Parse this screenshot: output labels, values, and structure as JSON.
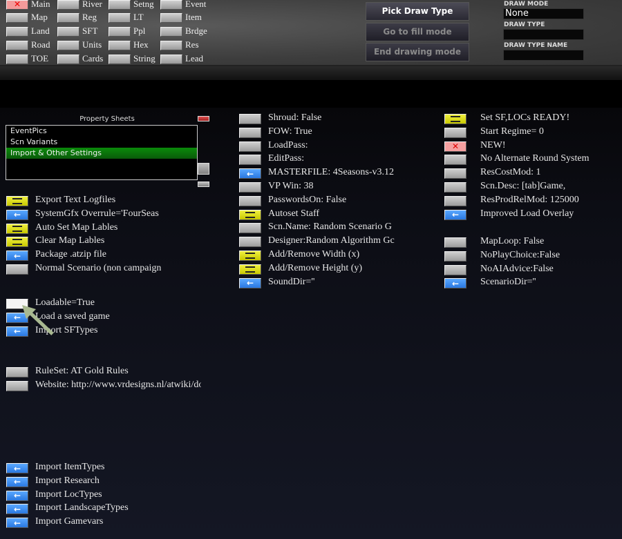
{
  "top_grid": [
    [
      "Main",
      "River",
      "Setng",
      "Event"
    ],
    [
      "Map",
      "Reg",
      "LT",
      "Item"
    ],
    [
      "Land",
      "SFT",
      "Ppl",
      "Brdge"
    ],
    [
      "Road",
      "Units",
      "Hex",
      "Res"
    ],
    [
      "TOE",
      "Cards",
      "String",
      "Lead"
    ]
  ],
  "draw_buttons": {
    "pick": "Pick Draw Type",
    "fill": "Go to fill mode",
    "end": "End drawing mode"
  },
  "draw_panel": {
    "mode_label": "DRAW MODE",
    "mode_value": "None",
    "type_label": "DRAW TYPE",
    "type_value": "",
    "name_label": "DRAW TYPE NAME",
    "name_value": ""
  },
  "property_sheets": {
    "title": "Property Sheets",
    "items": [
      "EventPics",
      "Scn Variants",
      "Import & Other Settings"
    ],
    "selected": 2
  },
  "left_column": [
    [
      {
        "t": "Export Text Logfiles",
        "b": "yellow"
      },
      {
        "t": "SystemGfx  Overrule='FourSeas",
        "b": "blue"
      },
      {
        "t": "Auto Set Map Lables",
        "b": "yellow"
      },
      {
        "t": "Clear Map Lables",
        "b": "yellow"
      },
      {
        "t": "Package .atzip file",
        "b": "blue"
      },
      {
        "t": "Normal Scenario (non campaign",
        "b": "grey"
      }
    ],
    [
      {
        "t": "Loadable=True",
        "b": "white"
      },
      {
        "t": "Load a saved game",
        "b": "blue"
      },
      {
        "t": "Import SFTypes",
        "b": "blue"
      }
    ],
    [
      {
        "t": "RuleSet: AT Gold Rules",
        "b": "grey"
      },
      {
        "t": "Website:  http://www.vrdesigns.nl/atwiki/doku.php?id=atg:at_g",
        "b": "grey"
      }
    ],
    [
      {
        "t": "Import ItemTypes",
        "b": "blue"
      },
      {
        "t": "Import Research",
        "b": "blue"
      },
      {
        "t": "Import LocTypes",
        "b": "blue"
      },
      {
        "t": "Import LandscapeTypes",
        "b": "blue"
      },
      {
        "t": "Import Gamevars",
        "b": "blue"
      }
    ]
  ],
  "middle_column": [
    [
      {
        "t": "Shroud: False",
        "b": "grey"
      },
      {
        "t": "FOW: True",
        "b": "grey"
      },
      {
        "t": "LoadPass:",
        "b": "grey"
      },
      {
        "t": "EditPass:",
        "b": "grey"
      },
      {
        "t": "MASTERFILE: 4Seasons-v3.12",
        "b": "blue"
      },
      {
        "t": "VP Win:  38",
        "b": "grey"
      },
      {
        "t": "PasswordsOn: False",
        "b": "grey"
      },
      {
        "t": "Autoset Staff",
        "b": "yellow"
      },
      {
        "t": "Scn.Name: Random Scenario G",
        "b": "grey"
      },
      {
        "t": "Designer:Random  Algorithm  Gc",
        "b": "grey"
      },
      {
        "t": "Add/Remove Width (x)",
        "b": "yellow"
      },
      {
        "t": "Add/Remove Height (y)",
        "b": "yellow"
      },
      {
        "t": "  SoundDir=''",
        "b": "blue"
      }
    ]
  ],
  "right_column": [
    [
      {
        "t": "Set SF,LOCs READY!",
        "b": "yellow"
      },
      {
        "t": "Start Regime= 0",
        "b": "grey"
      },
      {
        "t": "NEW!",
        "b": "red"
      },
      {
        "t": "No Alternate Round System",
        "b": "grey"
      },
      {
        "t": "ResCostMod:  1",
        "b": "grey"
      },
      {
        "t": "Scn.Desc: [tab]Game,",
        "b": "grey"
      },
      {
        "t": "ResProdRelMod:  125000",
        "b": "grey"
      },
      {
        "t": "Improved Load Overlay",
        "b": "blue"
      }
    ],
    [
      {
        "t": "MapLoop: False",
        "b": "grey"
      },
      {
        "t": "NoPlayChoice:False",
        "b": "grey"
      },
      {
        "t": "NoAIAdvice:False",
        "b": "grey"
      },
      {
        "t": "ScenarioDir=''",
        "b": "blue"
      }
    ]
  ],
  "colors": {
    "yellow": "#e0e020",
    "blue": "#3a8cf0",
    "red": "#f5a0a0",
    "selected": "#0a7a0a"
  }
}
